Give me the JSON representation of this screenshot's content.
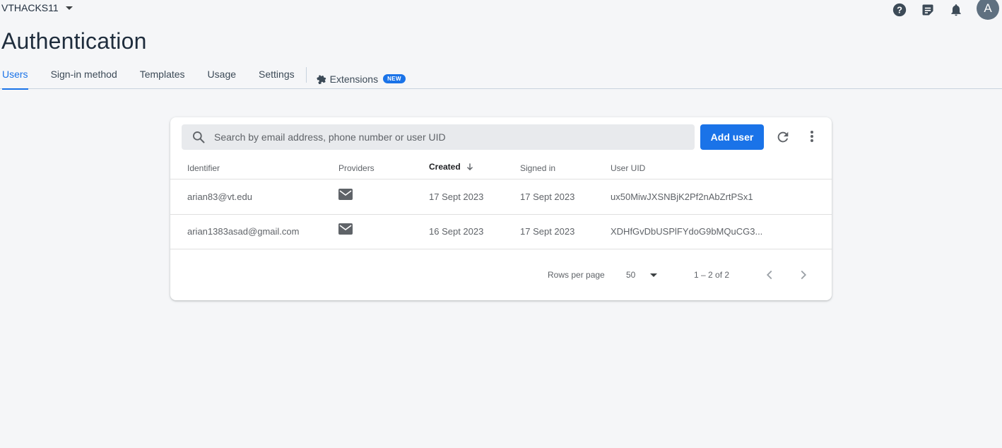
{
  "project": {
    "name": "VTHACKS11"
  },
  "header": {
    "avatar_letter": "A",
    "icons": [
      "help-icon",
      "release-notes-icon",
      "notifications-icon"
    ]
  },
  "page": {
    "title": "Authentication"
  },
  "tabs": [
    {
      "label": "Users",
      "active": true
    },
    {
      "label": "Sign-in method"
    },
    {
      "label": "Templates"
    },
    {
      "label": "Usage"
    },
    {
      "label": "Settings"
    },
    {
      "label": "Extensions",
      "badge": "NEW"
    }
  ],
  "toolbar": {
    "search_placeholder": "Search by email address, phone number or user UID",
    "add_user_label": "Add user"
  },
  "table": {
    "columns": [
      "Identifier",
      "Providers",
      "Created",
      "Signed in",
      "User UID"
    ],
    "sorted_column": "Created",
    "rows": [
      {
        "identifier": "arian83@vt.edu",
        "provider": "email-icon",
        "created": "17 Sept 2023",
        "signed_in": "17 Sept 2023",
        "uid": "ux50MiwJXSNBjK2Pf2nAbZrtPSx1"
      },
      {
        "identifier": "arian1383asad@gmail.com",
        "provider": "email-icon",
        "created": "16 Sept 2023",
        "signed_in": "17 Sept 2023",
        "uid": "XDHfGvDbUSPlFYdoG9bMQuCG3..."
      }
    ]
  },
  "pagination": {
    "rows_per_page_label": "Rows per page",
    "rows_per_page_value": "50",
    "range_label": "1 – 2 of 2"
  },
  "colors": {
    "accent": "#1a73e8",
    "background": "#f5f6f8"
  }
}
